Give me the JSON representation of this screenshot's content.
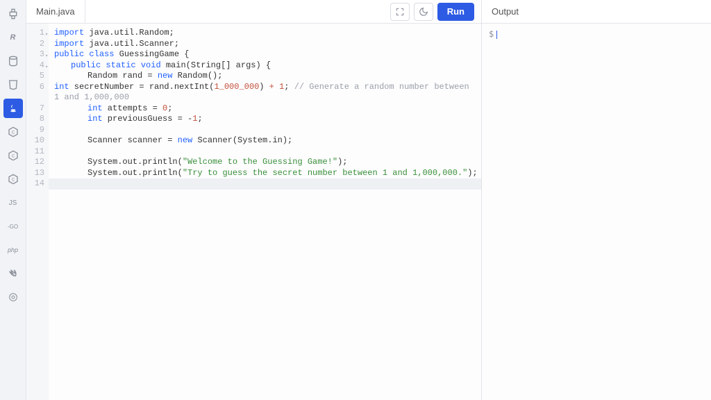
{
  "sidebar": {
    "items": [
      {
        "name": "python-icon",
        "label": "Py",
        "active": false
      },
      {
        "name": "r-icon",
        "label": "R",
        "active": false
      },
      {
        "name": "sql-icon",
        "label": "DB",
        "active": false
      },
      {
        "name": "html-icon",
        "label": "H5",
        "active": false
      },
      {
        "name": "java-icon",
        "label": "J",
        "active": true
      },
      {
        "name": "c-icon",
        "label": "C",
        "active": false
      },
      {
        "name": "cpp-icon",
        "label": "C",
        "active": false
      },
      {
        "name": "csharp-icon",
        "label": "C",
        "active": false
      },
      {
        "name": "js-icon",
        "label": "JS",
        "active": false
      },
      {
        "name": "go-icon",
        "label": "-GO",
        "active": false
      },
      {
        "name": "php-icon",
        "label": "php",
        "active": false
      },
      {
        "name": "swift-icon",
        "label": "Sw",
        "active": false
      },
      {
        "name": "rust-icon",
        "label": "R",
        "active": false
      }
    ]
  },
  "editor": {
    "tab_label": "Main.java",
    "run_label": "Run",
    "lines": [
      {
        "n": "1",
        "fold": true
      },
      {
        "n": "2",
        "fold": false
      },
      {
        "n": "3",
        "fold": true
      },
      {
        "n": "4",
        "fold": true
      },
      {
        "n": "5",
        "fold": false
      },
      {
        "n": "6",
        "fold": false
      },
      {
        "n": "7",
        "fold": false
      },
      {
        "n": "8",
        "fold": false
      },
      {
        "n": "9",
        "fold": false
      },
      {
        "n": "10",
        "fold": false
      },
      {
        "n": "11",
        "fold": false
      },
      {
        "n": "12",
        "fold": false
      },
      {
        "n": "13",
        "fold": false
      },
      {
        "n": "14",
        "fold": false
      }
    ],
    "tok": {
      "import": "import",
      "pkg_random": " java.util.Random;",
      "pkg_scanner": " java.util.Scanner;",
      "public": "public",
      "class": "class",
      "GuessingGame": " GuessingGame {",
      "static": "static",
      "void": "void",
      "main_sig": " main(String[] args) {",
      "Random_decl": "Random rand = ",
      "new": "new",
      "Random_ctor": " Random();",
      "int": "int",
      "secret1": " secretNumber = rand.nextInt(",
      "million": "1_000_000",
      "secret2": ") ",
      "plus": "+",
      "space": " ",
      "one": "1",
      "semi": "; ",
      "cmt_gen": "// Generate a random number between 1 and 1,000,000",
      "attempts": " attempts = ",
      "zero": "0",
      "semi2": ";",
      "prev": " previousGuess = -",
      "one2": "1",
      "semi3": ";",
      "Scanner_decl": "Scanner scanner = ",
      "Scanner_ctor": " Scanner(System.in);",
      "sys": "System.out.println(",
      "str_welcome": "\"Welcome to the Guessing Game!\"",
      "close_paren": ");",
      "str_try": "\"Try to guess the secret number between 1 and 1,000,000.\""
    }
  },
  "output": {
    "header": "Output",
    "prompt": "$"
  }
}
